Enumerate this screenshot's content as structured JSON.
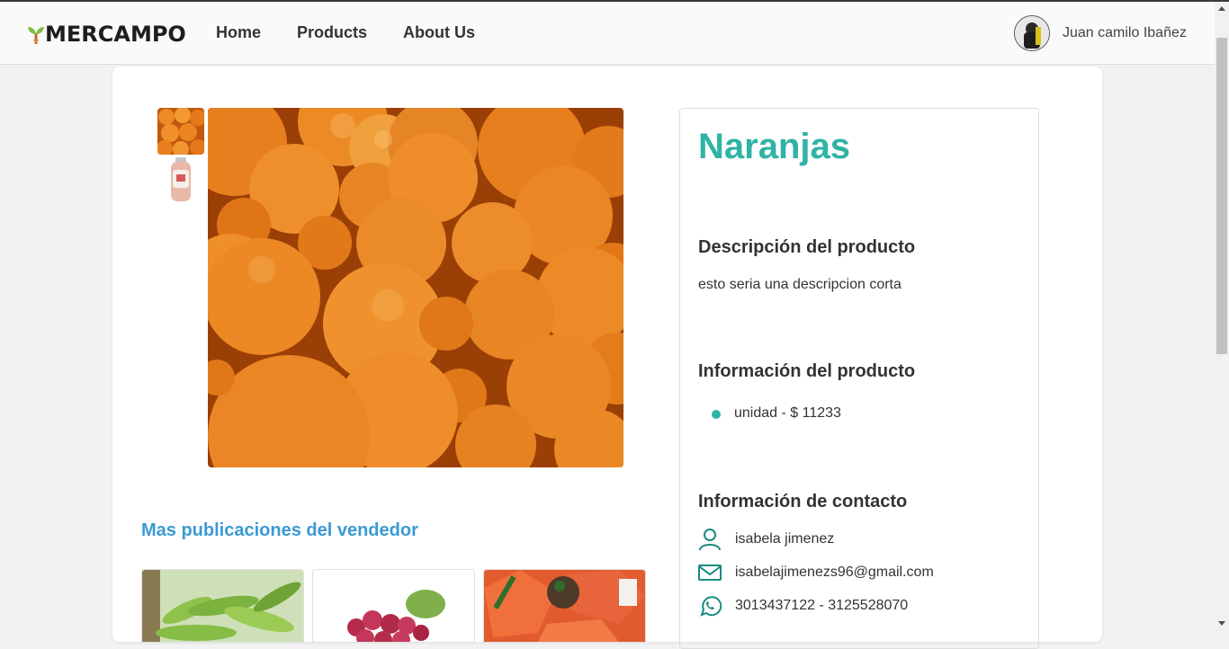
{
  "app": {
    "logo_text": "MERCAMPO",
    "accent_color": "#2fb3a5",
    "link_color": "#3a9ad3"
  },
  "nav": {
    "links": [
      "Home",
      "Products",
      "About Us"
    ],
    "user_name": "Juan camilo Ibañez"
  },
  "product": {
    "title": "Naranjas",
    "description_heading": "Descripción del producto",
    "description": "esto seria una descripcion corta",
    "info_heading": "Información del producto",
    "presentations": [
      "unidad - $ 11233"
    ],
    "contact_heading": "Información de contacto",
    "contact": {
      "name": "isabela jimenez",
      "email": "isabelajimenezs96@gmail.com",
      "phones": "3013437122 - 3125528070"
    }
  },
  "seller": {
    "more_heading": "Mas publicaciones del vendedor"
  },
  "icons": {
    "user": "user-icon",
    "mail": "mail-icon",
    "whatsapp": "whatsapp-icon"
  }
}
